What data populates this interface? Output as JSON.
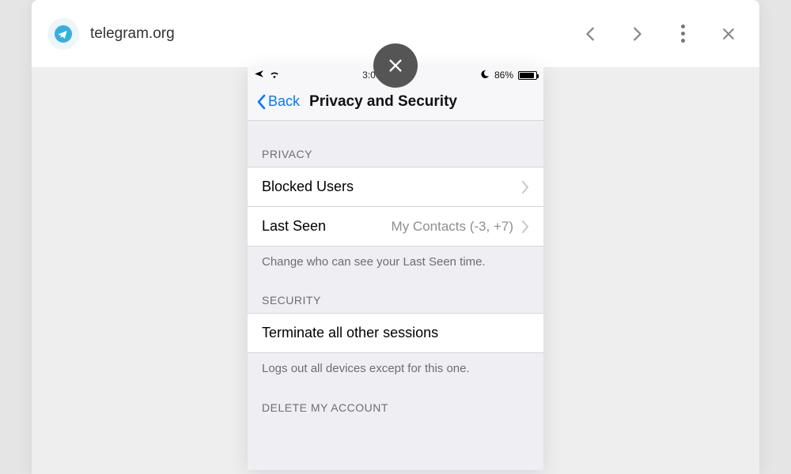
{
  "topbar": {
    "site_url": "telegram.org"
  },
  "status": {
    "time": "3:00 PM",
    "battery_label": "86%"
  },
  "nav": {
    "back_label": "Back",
    "title": "Privacy and Security"
  },
  "sections": {
    "privacy": {
      "header": "PRIVACY",
      "blocked_users_label": "Blocked Users",
      "last_seen_label": "Last Seen",
      "last_seen_value": "My Contacts (-3, +7)",
      "footer": "Change who can see your Last Seen time."
    },
    "security": {
      "header": "SECURITY",
      "terminate_label": "Terminate all other sessions",
      "footer": "Logs out all devices except for this one."
    },
    "delete": {
      "header": "DELETE MY ACCOUNT"
    }
  }
}
